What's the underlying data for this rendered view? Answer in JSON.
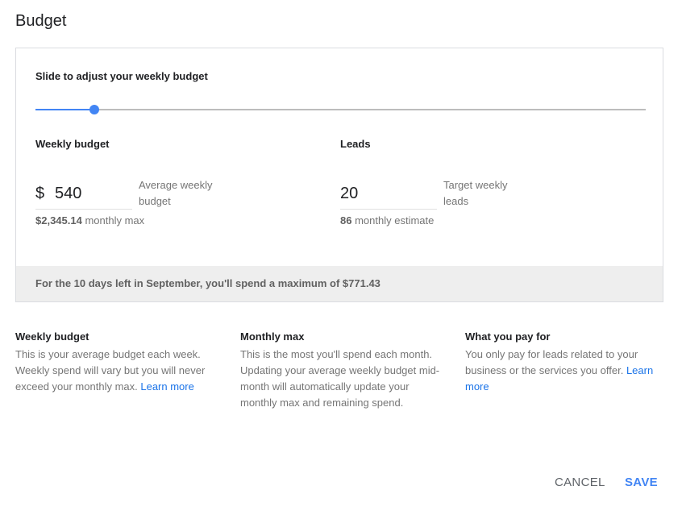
{
  "dialog": {
    "title": "Budget"
  },
  "slider": {
    "label": "Slide to adjust your weekly budget",
    "value_fraction": 0.096
  },
  "weekly_budget": {
    "heading": "Weekly budget",
    "currency": "$",
    "value": "540",
    "description": "Average weekly budget",
    "sub_value": "$2,345.14",
    "sub_label": "monthly max"
  },
  "leads": {
    "heading": "Leads",
    "value": "20",
    "description": "Target weekly leads",
    "sub_value": "86",
    "sub_label": "monthly estimate"
  },
  "notice": "For the 10 days left in September, you'll spend a maximum of $771.43",
  "info": [
    {
      "heading": "Weekly budget",
      "text": "This is your average budget each week. Weekly spend will vary but you will never exceed your monthly max.",
      "link": "Learn more"
    },
    {
      "heading": "Monthly max",
      "text": "This is the most you'll spend each month. Updating your average weekly budget mid-month will automatically update your monthly max and remaining spend."
    },
    {
      "heading": "What you pay for",
      "text": "You only pay for leads related to your business or the services you offer.",
      "link": "Learn more"
    }
  ],
  "buttons": {
    "cancel": "CANCEL",
    "save": "SAVE"
  },
  "colors": {
    "accent": "#4285f4",
    "link": "#1a73e8",
    "notice_bg": "#eeeeee"
  }
}
